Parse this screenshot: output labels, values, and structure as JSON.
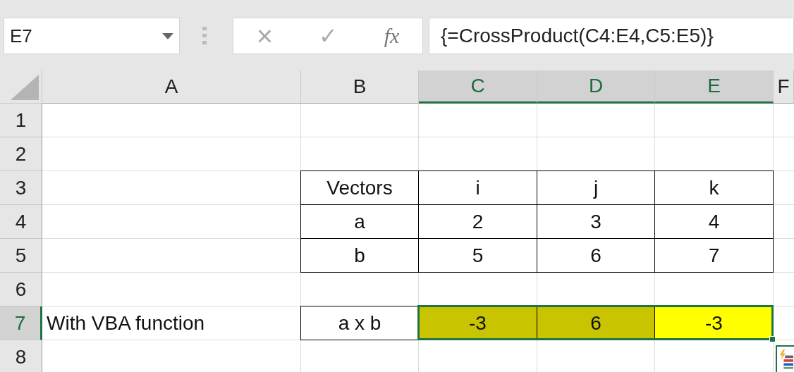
{
  "name_box": {
    "value": "E7"
  },
  "formula_bar": {
    "cancel": "×",
    "enter": "✓",
    "fx": "fx",
    "value": "{=CrossProduct(C4:E4,C5:E5)}"
  },
  "columns": [
    {
      "label": "A",
      "selected": false
    },
    {
      "label": "B",
      "selected": false
    },
    {
      "label": "C",
      "selected": true
    },
    {
      "label": "D",
      "selected": true
    },
    {
      "label": "E",
      "selected": true
    },
    {
      "label": "F",
      "selected": false
    }
  ],
  "rows": [
    {
      "label": "1",
      "selected": false,
      "cells": [
        {},
        {},
        {},
        {},
        {}
      ]
    },
    {
      "label": "2",
      "selected": false,
      "cells": [
        {},
        {},
        {},
        {},
        {}
      ]
    },
    {
      "label": "3",
      "selected": false,
      "cells": [
        {},
        {
          "text": "Vectors",
          "bordered": true
        },
        {
          "text": "i",
          "bordered": true
        },
        {
          "text": "j",
          "bordered": true
        },
        {
          "text": "k",
          "bordered": true
        }
      ]
    },
    {
      "label": "4",
      "selected": false,
      "cells": [
        {},
        {
          "text": "a",
          "bordered": true
        },
        {
          "text": "2",
          "bordered": true
        },
        {
          "text": "3",
          "bordered": true
        },
        {
          "text": "4",
          "bordered": true
        }
      ]
    },
    {
      "label": "5",
      "selected": false,
      "cells": [
        {},
        {
          "text": "b",
          "bordered": true
        },
        {
          "text": "5",
          "bordered": true
        },
        {
          "text": "6",
          "bordered": true
        },
        {
          "text": "7",
          "bordered": true
        }
      ]
    },
    {
      "label": "6",
      "selected": false,
      "cells": [
        {},
        {},
        {},
        {},
        {}
      ]
    },
    {
      "label": "7",
      "selected": true,
      "cells": [
        {
          "text": "With VBA function"
        },
        {
          "text": "a x b",
          "bordered": true
        },
        {
          "text": "-3",
          "bordered": true,
          "color": "#c9c400",
          "selected": true
        },
        {
          "text": "6",
          "bordered": true,
          "color": "#c9c400",
          "selected": true
        },
        {
          "text": "-3",
          "bordered": true,
          "color": "#ffff00",
          "selected": true
        }
      ]
    },
    {
      "label": "8",
      "selected": false,
      "cells": [
        {},
        {},
        {},
        {},
        {}
      ]
    }
  ]
}
